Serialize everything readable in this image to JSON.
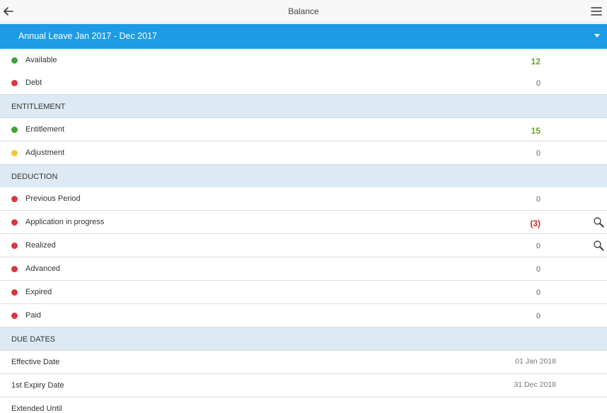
{
  "header": {
    "title": "Balance",
    "back_icon": "arrow-left-icon",
    "menu_icon": "hamburger-menu-icon"
  },
  "period": {
    "label": "Annual Leave Jan 2017 - Dec 2017"
  },
  "summary": [
    {
      "label": "Available",
      "value": "12",
      "status": "green"
    },
    {
      "label": "Debt",
      "value": "0",
      "status": "red"
    }
  ],
  "entitlement": {
    "heading": "ENTITLEMENT",
    "items": [
      {
        "label": "Entitlement",
        "value": "15",
        "status": "green"
      },
      {
        "label": "Adjustment",
        "value": "0",
        "status": "yellow"
      }
    ]
  },
  "deduction": {
    "heading": "DEDUCTION",
    "items": [
      {
        "label": "Previous Period",
        "value": "0",
        "status": "red"
      },
      {
        "label": "Application in progress",
        "value": "(3)",
        "status": "red"
      },
      {
        "label": "Realized",
        "value": "0",
        "status": "red"
      },
      {
        "label": "Advanced",
        "value": "0",
        "status": "red"
      },
      {
        "label": "Expired",
        "value": "0",
        "status": "red"
      },
      {
        "label": "Paid",
        "value": "0",
        "status": "red"
      }
    ]
  },
  "due_dates": {
    "heading": "DUE DATES",
    "items": [
      {
        "label": "Effective Date",
        "value": "01 Jan 2018"
      },
      {
        "label": "1st Expiry Date",
        "value": "31 Dec 2018"
      },
      {
        "label": "Extended Until",
        "value": ""
      }
    ]
  },
  "colors": {
    "accent": "#1e9be5",
    "section_bg": "#deeaf3",
    "green": "#3fa33a",
    "red": "#d9373f",
    "yellow": "#f7c53b"
  }
}
